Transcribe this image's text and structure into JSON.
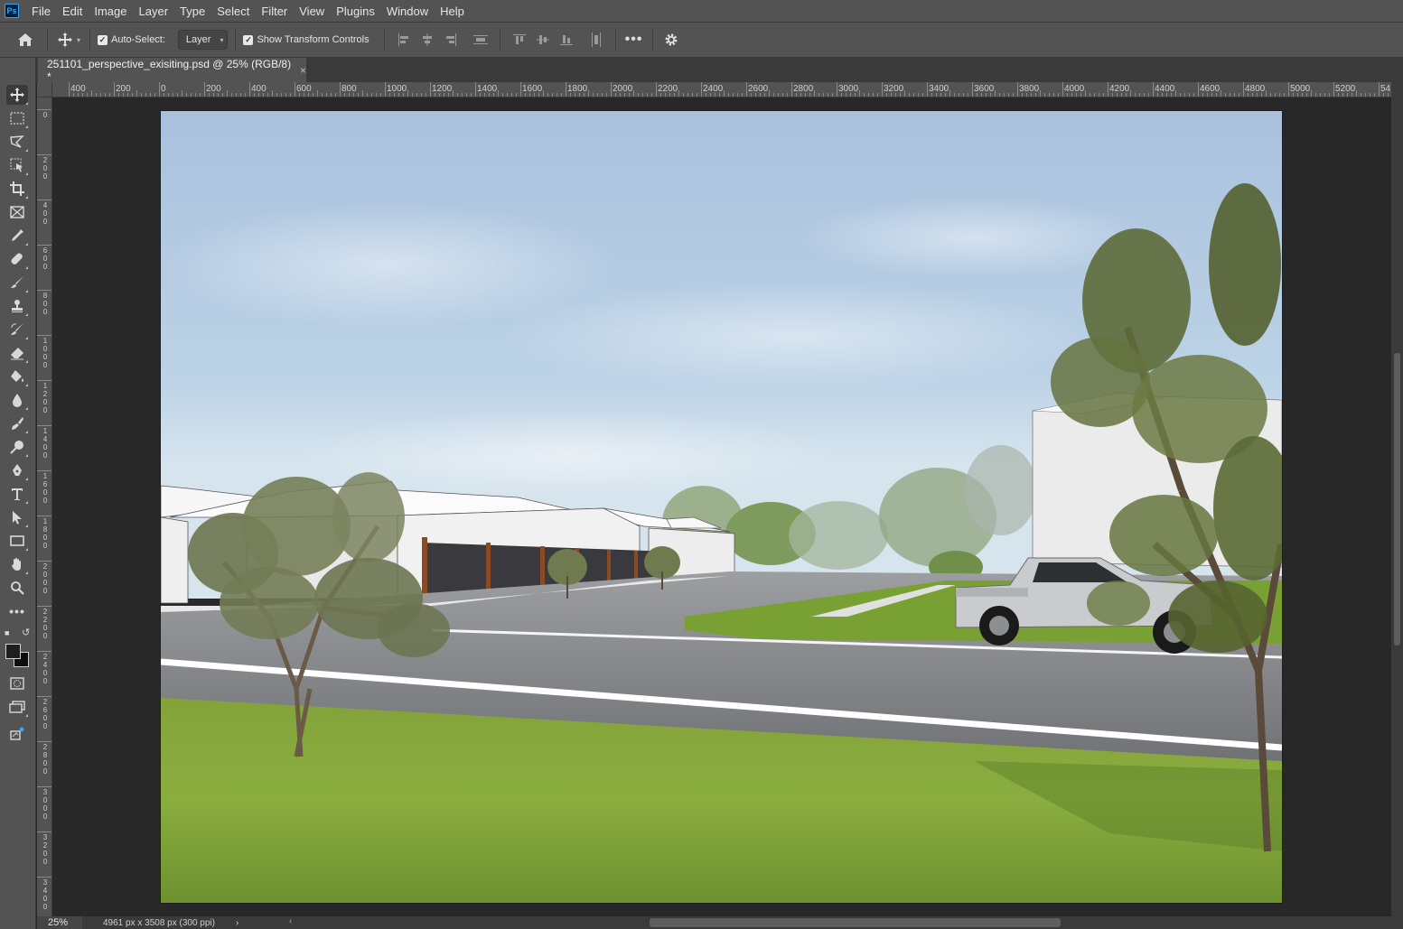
{
  "app": {
    "logo": "Ps"
  },
  "menu": [
    "File",
    "Edit",
    "Image",
    "Layer",
    "Type",
    "Select",
    "Filter",
    "View",
    "Plugins",
    "Window",
    "Help"
  ],
  "options": {
    "auto_select_label": "Auto-Select:",
    "auto_select_checked": true,
    "auto_select_target": "Layer",
    "transform_label": "Show Transform Controls",
    "transform_checked": true
  },
  "tab": {
    "title": "251101_perspective_exisiting.psd @ 25% (RGB/8) *",
    "close": "×"
  },
  "ruler": {
    "top_labels": [
      "400",
      "200",
      "0",
      "200",
      "400",
      "600",
      "800",
      "1000",
      "1200",
      "1400",
      "1600",
      "1800",
      "2000",
      "2200",
      "2400",
      "2600",
      "2800",
      "3000",
      "3200",
      "3400",
      "3600",
      "3800",
      "4000",
      "4200",
      "4400",
      "4600",
      "4800",
      "5000",
      "5200",
      "54"
    ],
    "left_labels": [
      "0",
      "200",
      "400",
      "600",
      "800",
      "1000",
      "1200",
      "1400",
      "1600",
      "1800",
      "2000",
      "2200",
      "2400",
      "2600",
      "2800",
      "3000",
      "3200",
      "3400"
    ]
  },
  "status": {
    "zoom": "25%",
    "doc_info": "4961 px x 3508 px (300 ppi)"
  },
  "colors": {
    "chrome": "#535353",
    "panel_dark": "#3a3a3a",
    "pasteboard": "#282828",
    "ps_blue": "#31a8ff"
  },
  "tools": [
    "move-tool",
    "marquee-tool",
    "lasso-tool",
    "object-select-tool",
    "crop-tool",
    "frame-tool",
    "eyedropper-tool",
    "healing-brush-tool",
    "brush-tool",
    "clone-stamp-tool",
    "history-brush-tool",
    "eraser-tool",
    "paint-bucket-tool",
    "blur-tool",
    "smudge-tool",
    "dodge-tool",
    "pen-tool",
    "type-tool",
    "path-selection-tool",
    "rectangle-tool",
    "hand-tool",
    "zoom-tool",
    "more-tools",
    "quick-mask",
    "screen-mode",
    "share-icon"
  ]
}
